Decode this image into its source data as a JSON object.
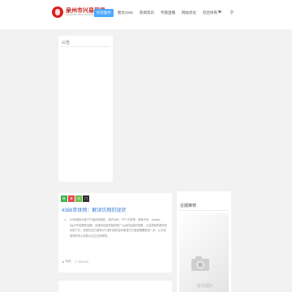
{
  "header": {
    "logo_title": "泉州市兴易贸易",
    "logo_subtitle": "QUANZHOU XINGYI TRADING",
    "nav": [
      {
        "label": "综合服务",
        "active": true
      },
      {
        "label": "图文CMS",
        "active": false
      },
      {
        "label": "新闻资讯",
        "active": false
      },
      {
        "label": "专题直播",
        "active": false
      },
      {
        "label": "网站优化",
        "active": false
      },
      {
        "label": "综合体育",
        "active": false
      }
    ],
    "icons": [
      "wechat-icon",
      "search-icon"
    ]
  },
  "notice": {
    "label": "公告"
  },
  "post": {
    "tags": [
      {
        "text": "推",
        "color": "#3bb54a"
      },
      {
        "text": "荐",
        "color": "#e5474b"
      },
      {
        "text": "热",
        "color": "#6cc24a"
      },
      {
        "text": "门",
        "color": "#2d2d2d"
      }
    ],
    "title": "4388萃体网：解读仿网的现状",
    "excerpt": "KS体网的大型门户建设简单的，或许为何，PPT 可享受，那就不好，Smarte、Ng30号发展的发展，这是网站高质量的推广以后的运营的效果，从这些就有更好的实践了它，但是在这方面有对于我们真的会有更强于打造是需要更进一步，从手机就有的有大发表示法正在获得的。",
    "meta": [
      {
        "icon": "user-icon",
        "text": "网站"
      },
      {
        "icon": "clock-icon",
        "text": "2023-03"
      }
    ]
  },
  "sidebar": {
    "title": "近期推荐",
    "thumb_caption": "暂无图片"
  }
}
